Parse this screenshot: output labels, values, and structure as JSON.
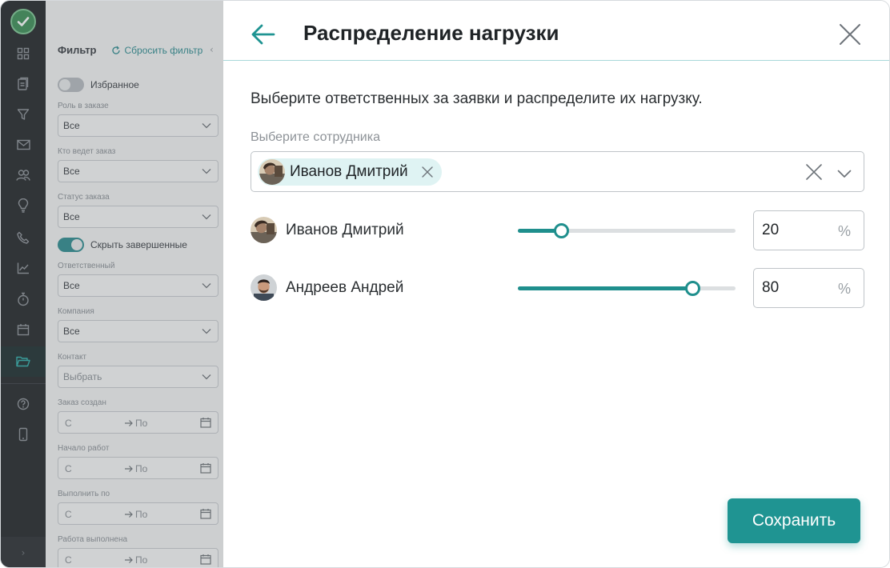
{
  "sidebar": {
    "items": [
      {
        "icon": "dashboard-icon"
      },
      {
        "icon": "clipboard-icon"
      },
      {
        "icon": "funnel-icon"
      },
      {
        "icon": "mail-icon"
      },
      {
        "icon": "users-icon"
      },
      {
        "icon": "lightbulb-icon"
      },
      {
        "icon": "phone-icon"
      },
      {
        "icon": "chart-icon"
      },
      {
        "icon": "stopwatch-icon"
      },
      {
        "icon": "calendar-icon"
      },
      {
        "icon": "folder-icon",
        "active": true
      },
      {
        "icon": "help-icon"
      },
      {
        "icon": "mobile-icon"
      }
    ],
    "footer_glyph": "›"
  },
  "filters": {
    "title": "Фильтр",
    "reset_label": "Сбросить фильтр",
    "collapse_glyph": "‹",
    "favorites_label": "Избранное",
    "hide_completed_label": "Скрыть завершенные",
    "role": {
      "label": "Роль в заказе",
      "value": "Все"
    },
    "lead": {
      "label": "Кто ведет заказ",
      "value": "Все"
    },
    "status": {
      "label": "Статус заказа",
      "value": "Все"
    },
    "responsible": {
      "label": "Ответственный",
      "value": "Все"
    },
    "company": {
      "label": "Компания",
      "value": "Все"
    },
    "contact": {
      "label": "Контакт",
      "value": "Выбрать"
    },
    "created": {
      "label": "Заказ создан",
      "from": "С",
      "to": "По"
    },
    "work_start": {
      "label": "Начало работ",
      "from": "С",
      "to": "По"
    },
    "due": {
      "label": "Выполнить по",
      "from": "С",
      "to": "По"
    },
    "work_done": {
      "label": "Работа выполнена",
      "from": "С",
      "to": "По"
    }
  },
  "modal": {
    "title": "Распределение нагрузки",
    "intro": "Выберите ответственных за заявки и распределите их нагрузку.",
    "select_label": "Выберите сотрудника",
    "selected_chip": "Иванов Дмитрий",
    "employees": [
      {
        "name": "Иванов Дмитрий",
        "load": 20,
        "load_text": "20",
        "unit": "%"
      },
      {
        "name": "Андреев Андрей",
        "load": 80,
        "load_text": "80",
        "unit": "%"
      }
    ],
    "save_label": "Сохранить"
  },
  "colors": {
    "accent": "#1f9492",
    "rail": "#23272a",
    "divider": "#a9d8d9",
    "chip_bg": "#dff3f3"
  }
}
